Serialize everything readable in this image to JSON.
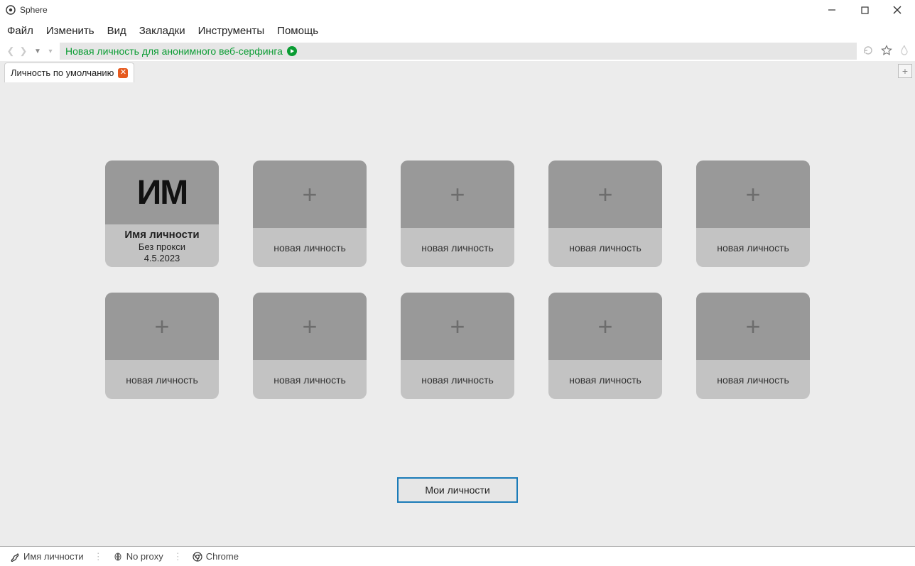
{
  "titlebar": {
    "app_name": "Sphere"
  },
  "menu": {
    "file": "Файл",
    "edit": "Изменить",
    "view": "Вид",
    "bookmarks": "Закладки",
    "tools": "Инструменты",
    "help": "Помощь"
  },
  "addressbar": {
    "text": "Новая личность для анонимного веб-серфинга"
  },
  "tab": {
    "label": "Личность по умолчанию"
  },
  "identity_card": {
    "initials": "ИМ",
    "name": "Имя личности",
    "proxy": "Без прокси",
    "date": "4.5.2023"
  },
  "new_card_label": "новая личность",
  "my_identities_button": "Мои личности",
  "statusbar": {
    "identity": "Имя личности",
    "proxy": "No proxy",
    "browser": "Chrome"
  }
}
